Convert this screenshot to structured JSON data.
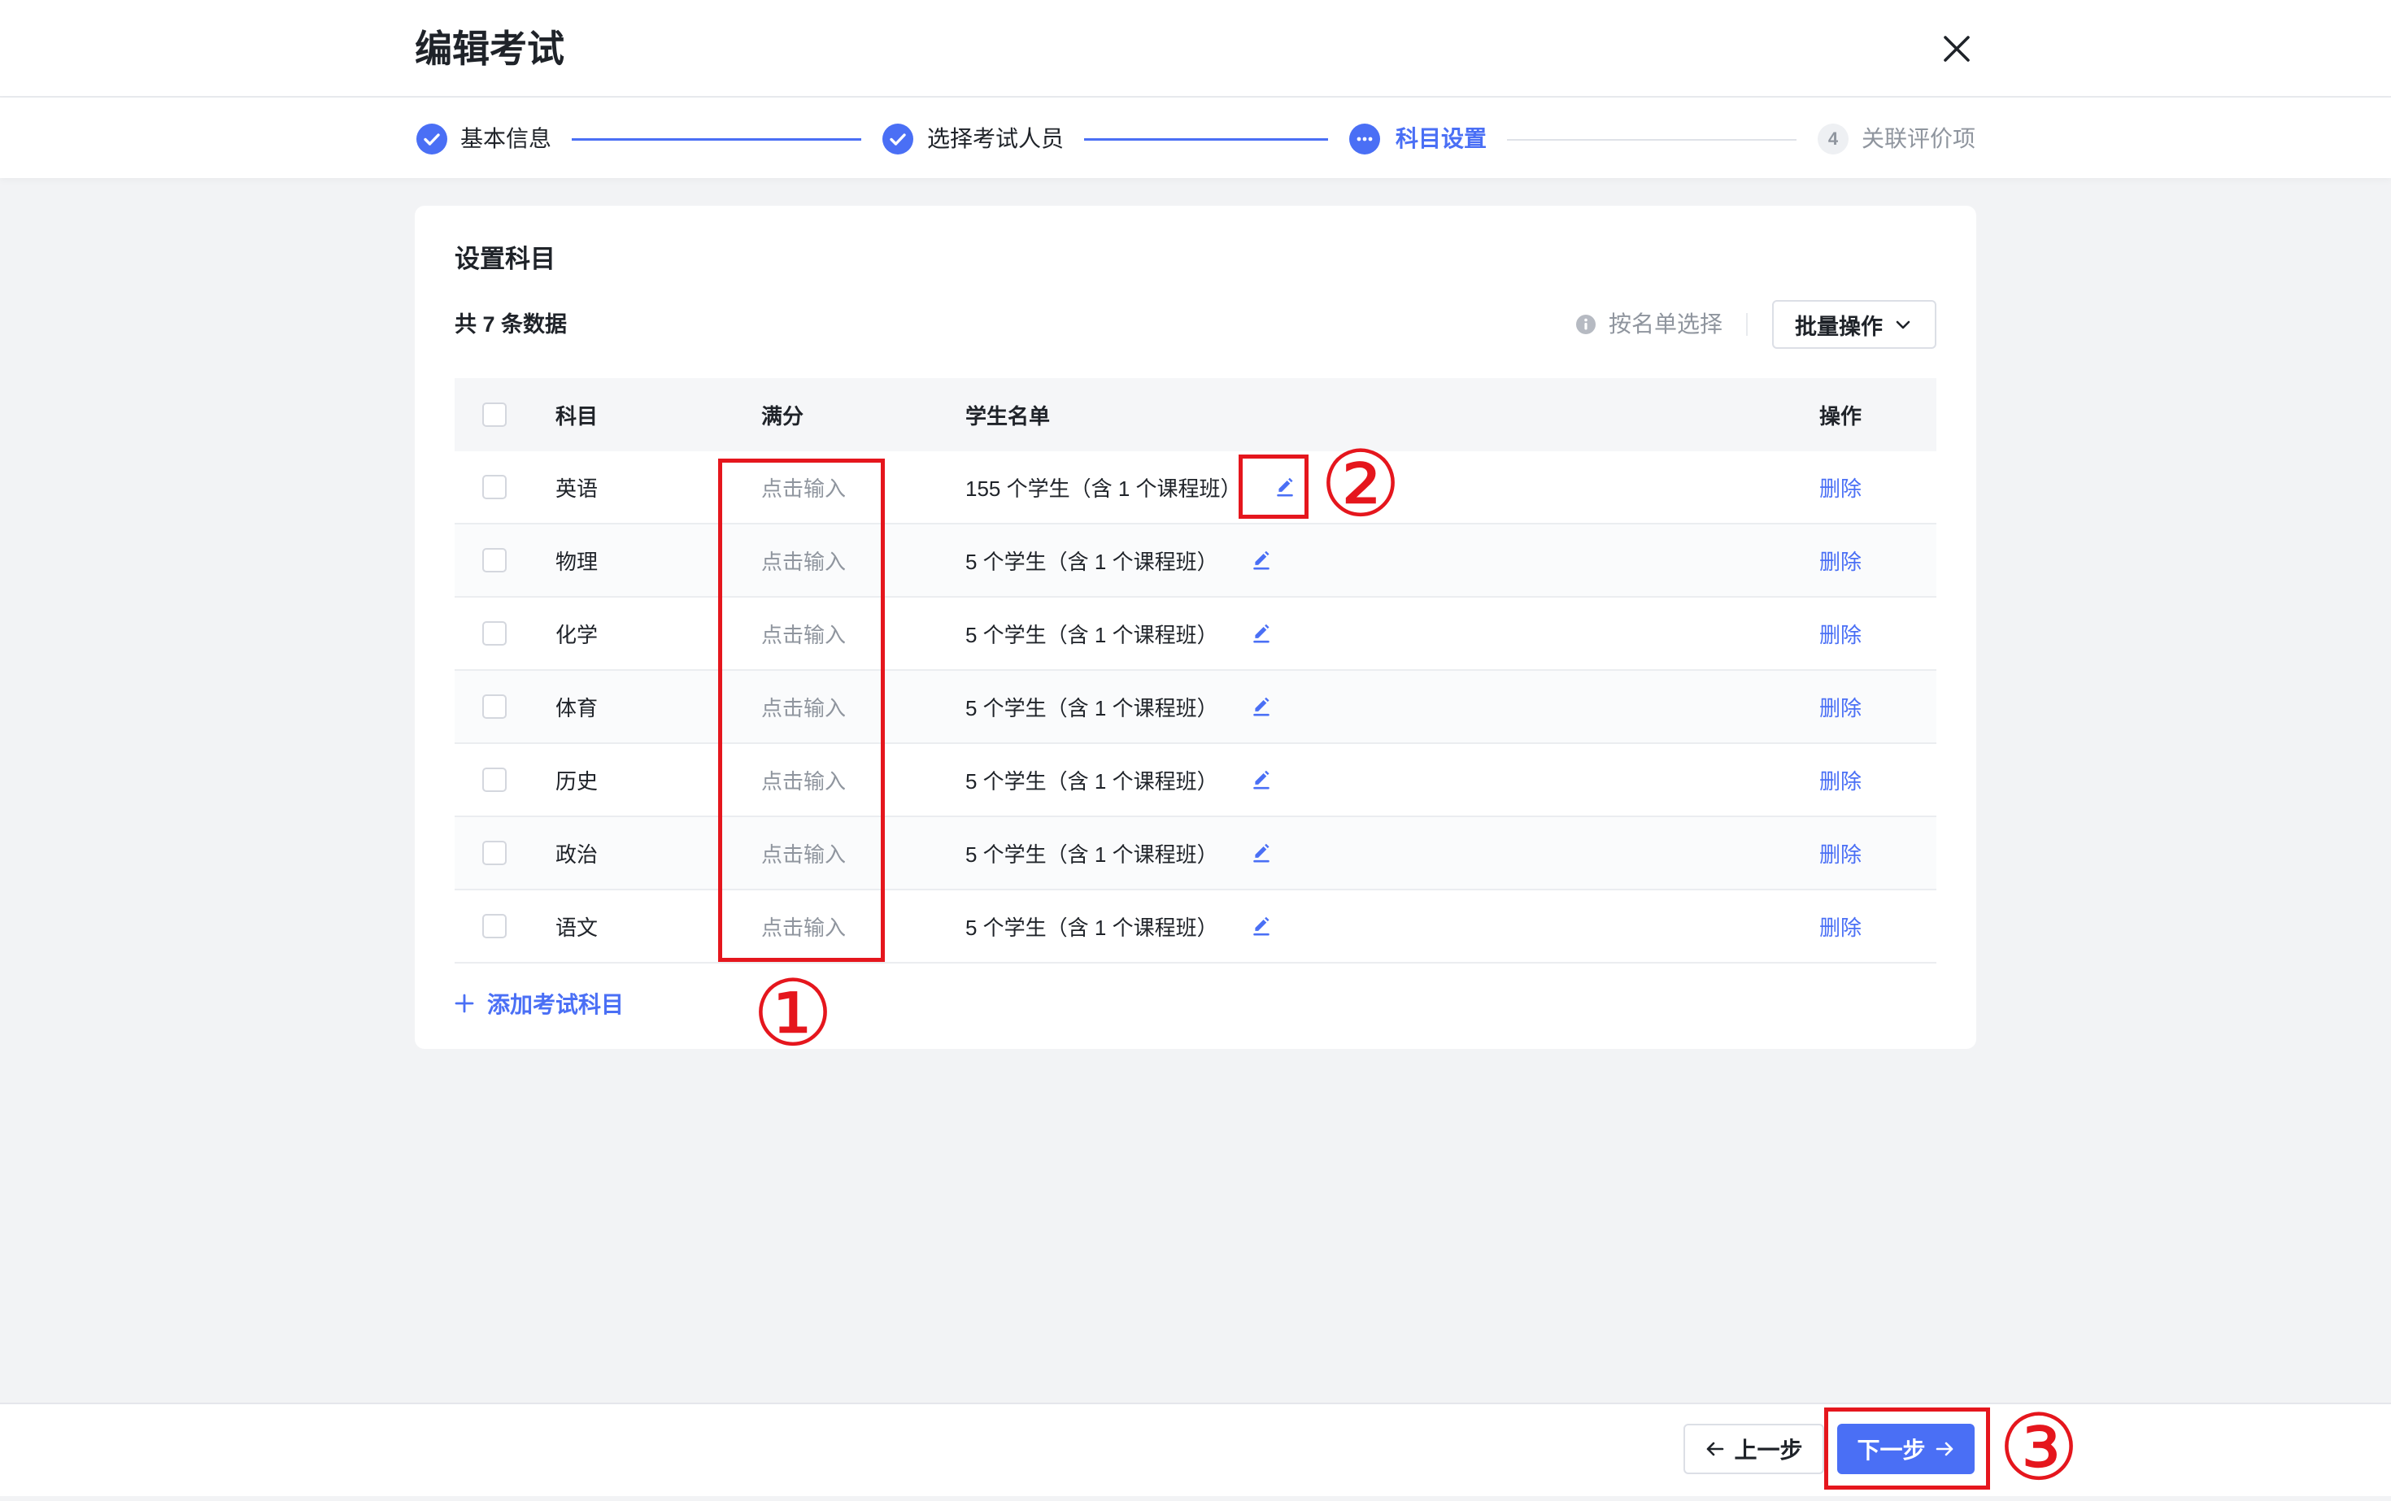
{
  "header": {
    "title": "编辑考试",
    "close_icon": "close-icon"
  },
  "steps": [
    {
      "icon": "check-circle-icon",
      "label": "基本信息"
    },
    {
      "icon": "check-circle-icon",
      "label": "选择考试人员"
    },
    {
      "icon": "more-dots-icon",
      "label": "科目设置"
    },
    {
      "number": "4",
      "label": "关联评价项"
    }
  ],
  "card": {
    "title": "设置科目",
    "count_text": "共 7 条数据",
    "info_icon": "info-icon",
    "select_by_list": "按名单选择",
    "batch_button": "批量操作",
    "batch_icon": "chevron-down-icon",
    "add_subject": "添加考试科目",
    "add_icon": "plus-icon"
  },
  "table": {
    "columns": [
      "科目",
      "满分",
      "学生名单",
      "操作"
    ],
    "rows": [
      {
        "subject": "英语",
        "full_score_placeholder": "点击输入",
        "students": "155 个学生（含 1 个课程班）",
        "action": "删除"
      },
      {
        "subject": "物理",
        "full_score_placeholder": "点击输入",
        "students": "5 个学生（含 1 个课程班）",
        "action": "删除"
      },
      {
        "subject": "化学",
        "full_score_placeholder": "点击输入",
        "students": "5 个学生（含 1 个课程班）",
        "action": "删除"
      },
      {
        "subject": "体育",
        "full_score_placeholder": "点击输入",
        "students": "5 个学生（含 1 个课程班）",
        "action": "删除"
      },
      {
        "subject": "历史",
        "full_score_placeholder": "点击输入",
        "students": "5 个学生（含 1 个课程班）",
        "action": "删除"
      },
      {
        "subject": "政治",
        "full_score_placeholder": "点击输入",
        "students": "5 个学生（含 1 个课程班）",
        "action": "删除"
      },
      {
        "subject": "语文",
        "full_score_placeholder": "点击输入",
        "students": "5 个学生（含 1 个课程班）",
        "action": "删除"
      }
    ],
    "edit_icon": "pencil-edit-icon"
  },
  "footer": {
    "prev_button": "上一步",
    "next_button": "下一步"
  },
  "annotations": [
    "①",
    "②",
    "③"
  ],
  "colors": {
    "primary": "#4a6ff5",
    "annotation_red": "#e5161d",
    "page_background": "#f2f3f5",
    "muted_text": "#8f959e"
  }
}
